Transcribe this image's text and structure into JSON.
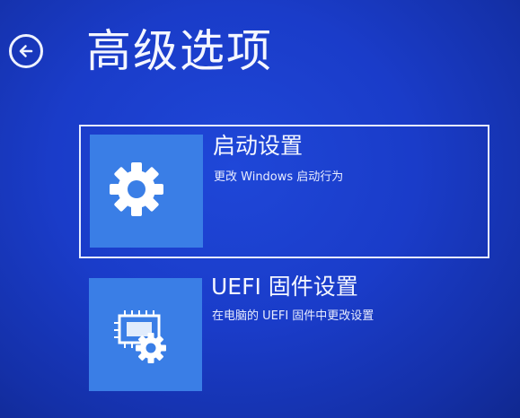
{
  "header": {
    "title": "高级选项",
    "back_icon": "back-arrow-icon"
  },
  "options": [
    {
      "title": "启动设置",
      "description": "更改 Windows 启动行为",
      "icon": "gear-icon",
      "selected": true
    },
    {
      "title": "UEFI 固件设置",
      "description": "在电脑的 UEFI 固件中更改设置",
      "icon": "firmware-chip-gear-icon",
      "selected": false
    }
  ],
  "colors": {
    "background": "#1a3cc9",
    "tile_icon_background": "#3a7ee6",
    "text": "#ffffff",
    "selection_border": "#e6ebff"
  }
}
